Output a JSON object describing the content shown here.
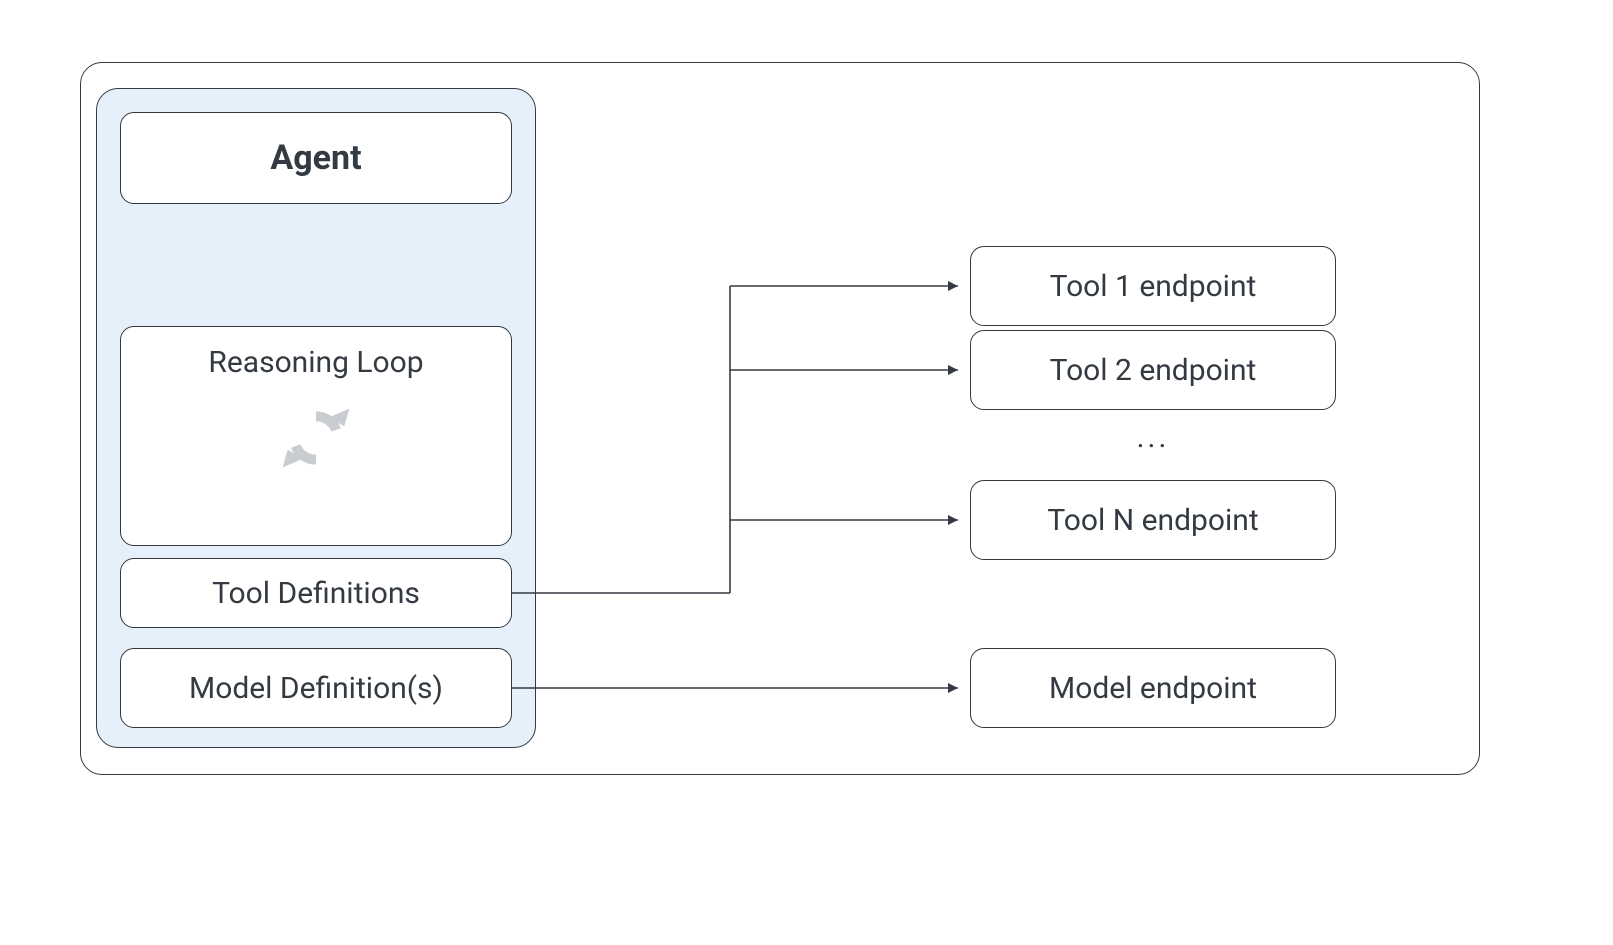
{
  "agent": {
    "title": "Agent",
    "reasoning_label": "Reasoning Loop",
    "tool_definitions_label": "Tool Definitions",
    "model_definitions_label": "Model Definition(s)"
  },
  "endpoints": {
    "tool1": "Tool 1 endpoint",
    "tool2": "Tool 2 endpoint",
    "ellipsis": "...",
    "toolN": "Tool N endpoint",
    "model": "Model endpoint"
  }
}
